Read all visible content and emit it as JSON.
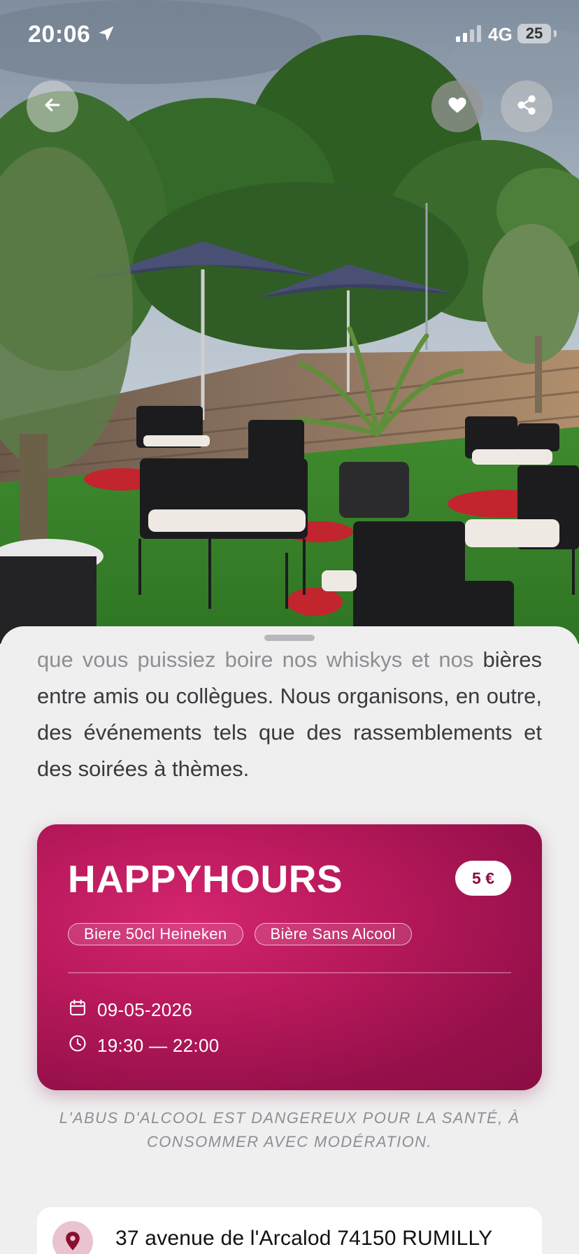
{
  "status_bar": {
    "time": "20:06",
    "network": "4G",
    "battery": "25",
    "location_icon": "location-arrow-icon",
    "signal_icon": "signal-bars-icon"
  },
  "header_actions": {
    "back_icon": "arrow-left-icon",
    "favorite_icon": "heart-icon",
    "share_icon": "share-icon"
  },
  "description": {
    "faded_line": "que vous puissiez boire nos whiskys et nos",
    "text": "bières entre amis ou collègues.  Nous organisons, en outre, des événements tels que des rassemblements et des soirées à thèmes."
  },
  "promo": {
    "title": "HAPPYHOURS",
    "price": "5 €",
    "tags": [
      "Biere 50cl Heineken",
      "Bière Sans Alcool"
    ],
    "date": "09-05-2026",
    "time": "19:30 — 22:00",
    "date_icon": "calendar-icon",
    "time_icon": "clock-icon",
    "colors": {
      "card_start": "#d4256f",
      "card_end": "#8a0e44"
    }
  },
  "warning": "L'ABUS D'ALCOOL EST DANGEREUX POUR LA SANTÉ, À CONSOMMER AVEC MODÉRATION.",
  "address": {
    "text": "37 avenue de l'Arcalod 74150 RUMILLY",
    "icon": "map-pin-icon"
  }
}
